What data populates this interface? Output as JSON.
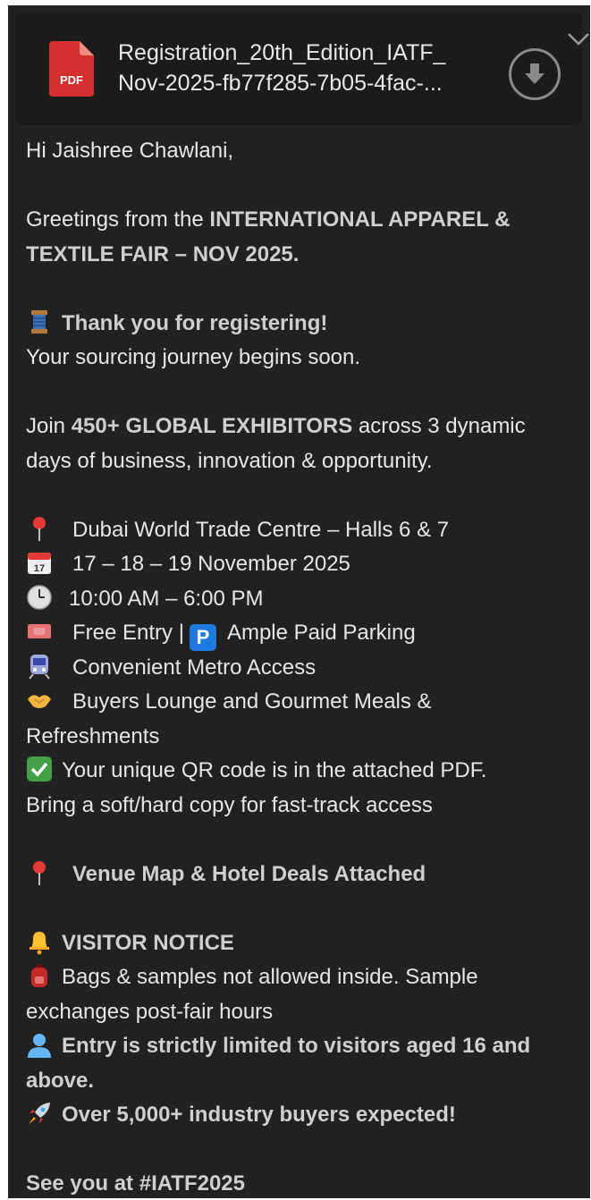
{
  "attachment": {
    "name_line1": "Registration_20th_Edition_IATF_",
    "name_line2": "Nov-2025-fb77f285-7b05-4fac-...",
    "type_label": "PDF"
  },
  "email": {
    "greeting": "Hi Jaishree Chawlani,",
    "intro_prefix": "Greetings from the ",
    "intro_bold_1": "INTERNATIONAL APPAREL &",
    "intro_bold_2": "TEXTILE FAIR – NOV 2025.",
    "thanks": "Thank you for registering!",
    "journey": "Your sourcing journey begins soon.",
    "join_prefix": "Join ",
    "join_bold": "450+ GLOBAL EXHIBITORS",
    "join_suffix": " across 3 dynamic",
    "join_line2": "days of business, innovation & opportunity.",
    "venue": "Dubai World Trade Centre – Halls 6 & 7",
    "dates": "17 – 18 – 19 November 2025",
    "hours": "10:00 AM – 6:00 PM",
    "entry": "Free Entry  |",
    "parking_badge": "P",
    "parking": "Ample Paid Parking",
    "metro": "Convenient Metro Access",
    "lounge_1": "Buyers Lounge and Gourmet Meals &",
    "lounge_2": "Refreshments",
    "qr_1": "Your unique QR code is in the attached PDF.",
    "qr_2": "Bring a soft/hard copy for fast-track access",
    "map": "Venue Map & Hotel Deals Attached",
    "notice_title": "VISITOR NOTICE",
    "bags_1": "Bags & samples not allowed inside. Sample",
    "bags_2": "exchanges post-fair hours",
    "age_1": "Entry is strictly limited to visitors aged 16 and",
    "age_2": "above.",
    "buyers": "Over 5,000+  industry buyers expected!",
    "signoff": "See you at #IATF2025"
  },
  "colors": {
    "background": "#212121",
    "text": "#e6e6e6",
    "pdf_red": "#d32f2f",
    "parking_blue": "#1e7ae0"
  }
}
